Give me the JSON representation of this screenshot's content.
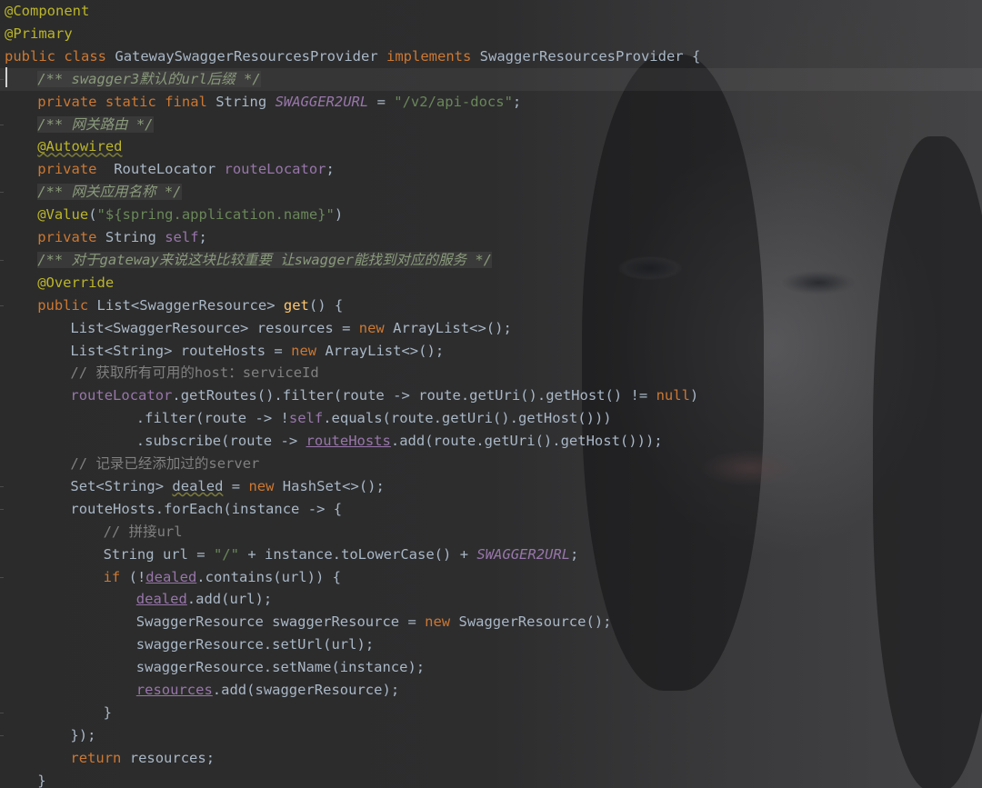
{
  "editor": {
    "lines": [
      {
        "t": "@Component"
      },
      {
        "t": "@Primary"
      },
      {
        "t": "public class GatewaySwaggerResourcesProvider implements SwaggerResourcesProvider {"
      },
      {
        "t": "/** swagger3默认的url后缀 */"
      },
      {
        "t": "private static final String SWAGGER2URL = \"/v2/api-docs\";"
      },
      {
        "t": "/** 网关路由 */"
      },
      {
        "t": "@Autowired"
      },
      {
        "t": "private  RouteLocator routeLocator;"
      },
      {
        "t": "/** 网关应用名称 */"
      },
      {
        "t": "@Value(\"${spring.application.name}\")"
      },
      {
        "t": "private String self;"
      },
      {
        "t": "/** 对于gateway来说这块比较重要 让swagger能找到对应的服务 */"
      },
      {
        "t": "@Override"
      },
      {
        "t": "public List<SwaggerResource> get() {"
      },
      {
        "t": "List<SwaggerResource> resources = new ArrayList<>();"
      },
      {
        "t": "List<String> routeHosts = new ArrayList<>();"
      },
      {
        "t": "// 获取所有可用的host：serviceId"
      },
      {
        "t": "routeLocator.getRoutes().filter(route -> route.getUri().getHost() != null)"
      },
      {
        "t": ".filter(route -> !self.equals(route.getUri().getHost()))"
      },
      {
        "t": ".subscribe(route -> routeHosts.add(route.getUri().getHost()));"
      },
      {
        "t": "// 记录已经添加过的server"
      },
      {
        "t": "Set<String> dealed = new HashSet<>();"
      },
      {
        "t": "routeHosts.forEach(instance -> {"
      },
      {
        "t": "// 拼接url"
      },
      {
        "t": "String url = \"/\" + instance.toLowerCase() + SWAGGER2URL;"
      },
      {
        "t": "if (!dealed.contains(url)) {"
      },
      {
        "t": "dealed.add(url);"
      },
      {
        "t": "SwaggerResource swaggerResource = new SwaggerResource();"
      },
      {
        "t": "swaggerResource.setUrl(url);"
      },
      {
        "t": "swaggerResource.setName(instance);"
      },
      {
        "t": "resources.add(swaggerResource);"
      },
      {
        "t": "}"
      },
      {
        "t": "});"
      },
      {
        "t": "return resources;"
      },
      {
        "t": "}"
      }
    ]
  }
}
